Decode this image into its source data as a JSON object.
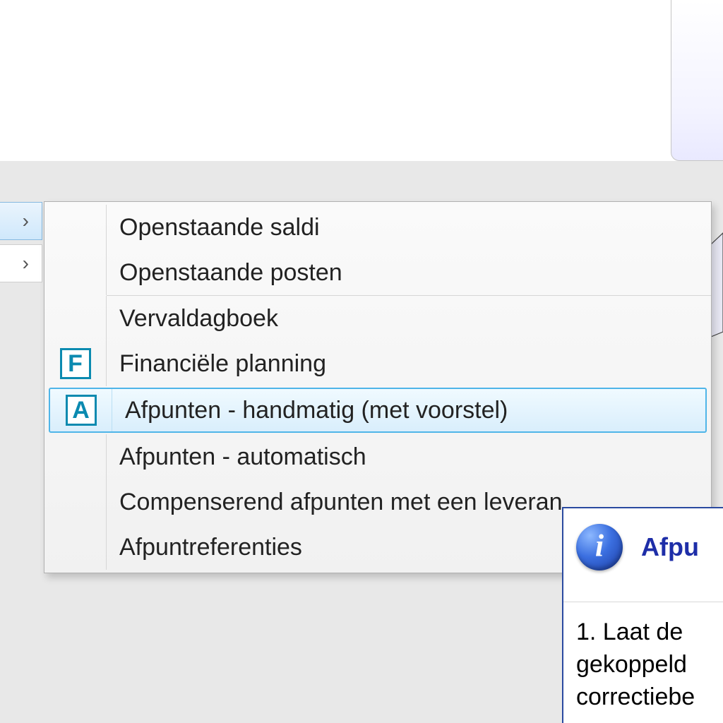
{
  "menu": {
    "items": [
      {
        "icon": "",
        "label": "Openstaande saldi"
      },
      {
        "icon": "",
        "label": "Openstaande posten"
      },
      {
        "icon": "",
        "label": "Vervaldagboek"
      },
      {
        "icon": "F",
        "label": "Financiële planning"
      },
      {
        "icon": "A",
        "label": "Afpunten - handmatig (met voorstel)"
      },
      {
        "icon": "",
        "label": "Afpunten - automatisch"
      },
      {
        "icon": "",
        "label": "Compenserend afpunten met een leveran"
      },
      {
        "icon": "",
        "label": "Afpuntreferenties"
      }
    ],
    "selected_index": 4
  },
  "left_chevron": "›",
  "info": {
    "title": "Afpu",
    "body_lines": [
      "1.  Laat de",
      "gekoppeld",
      "correctiebe"
    ]
  }
}
